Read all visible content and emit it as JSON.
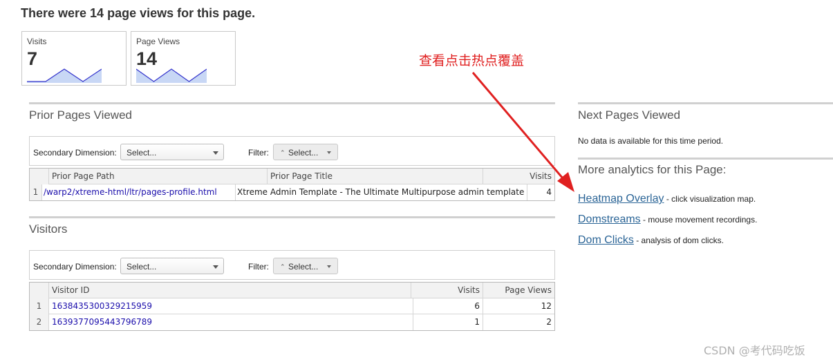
{
  "page_title": "There were 14 page views for this page.",
  "stats": [
    {
      "label": "Visits",
      "value": "7",
      "sparkline": [
        0,
        0,
        1,
        0,
        1
      ]
    },
    {
      "label": "Page Views",
      "value": "14",
      "sparkline": [
        1,
        0,
        1,
        0,
        1
      ]
    }
  ],
  "colors": {
    "sparkline_line": "#3333cc",
    "sparkline_fill": "#c8d7f5",
    "link": "#1a0dab",
    "analytics_link": "#2a6496",
    "annotation": "#e02020"
  },
  "prior_pages": {
    "title": "Prior Pages Viewed",
    "secondary_dimension_label": "Secondary Dimension:",
    "secondary_dimension_value": "Select...",
    "filter_label": "Filter:",
    "filter_value": "Select...",
    "columns": [
      "Prior Page Path",
      "Prior Page Title",
      "Visits"
    ],
    "rows": [
      {
        "index": "1",
        "path": "/warp2/xtreme-html/ltr/pages-profile.html",
        "page_title": "Xtreme Admin Template - The Ultimate Multipurpose admin template",
        "visits": "4"
      }
    ]
  },
  "visitors": {
    "title": "Visitors",
    "secondary_dimension_label": "Secondary Dimension:",
    "secondary_dimension_value": "Select...",
    "filter_label": "Filter:",
    "filter_value": "Select...",
    "columns": [
      "Visitor ID",
      "Visits",
      "Page Views"
    ],
    "rows": [
      {
        "index": "1",
        "visitor_id": "1638435300329215959",
        "visits": "6",
        "page_views": "12"
      },
      {
        "index": "2",
        "visitor_id": "1639377095443796789",
        "visits": "1",
        "page_views": "2"
      }
    ]
  },
  "next_pages": {
    "title": "Next Pages Viewed",
    "no_data": "No data is available for this time period."
  },
  "more_analytics": {
    "title": "More analytics for this Page:",
    "items": [
      {
        "link": "Heatmap Overlay",
        "desc": " - click visualization map."
      },
      {
        "link": "Domstreams",
        "desc": " - mouse movement recordings."
      },
      {
        "link": "Dom Clicks",
        "desc": " - analysis of dom clicks."
      }
    ]
  },
  "annotation": {
    "text": "查看点击热点覆盖",
    "icon": "red-arrow-icon"
  },
  "watermark": "CSDN @考代码吃饭"
}
